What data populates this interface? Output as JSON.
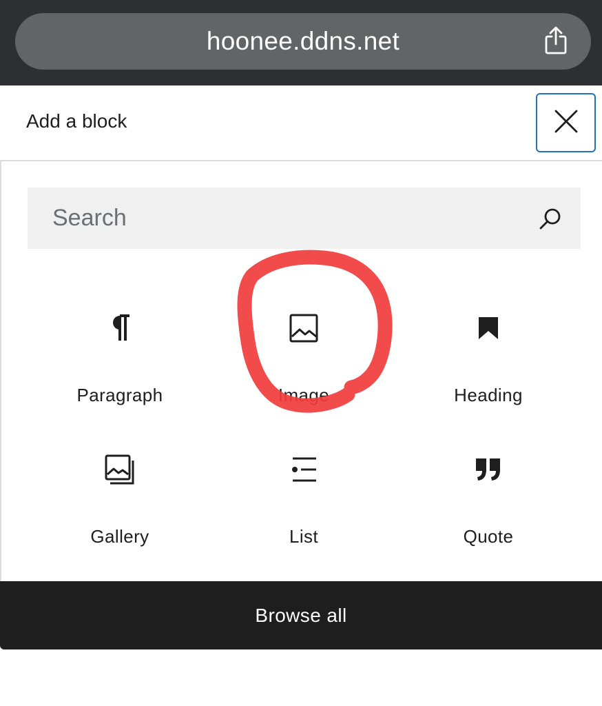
{
  "browser": {
    "url": "hoonee.ddns.net",
    "share_icon": "share-icon"
  },
  "header": {
    "title": "Add a block",
    "close_icon": "close-icon"
  },
  "search": {
    "placeholder": "Search",
    "value": "",
    "icon": "search-icon"
  },
  "blocks": [
    {
      "label": "Paragraph",
      "icon": "paragraph-icon"
    },
    {
      "label": "Image",
      "icon": "image-icon"
    },
    {
      "label": "Heading",
      "icon": "bookmark-icon"
    },
    {
      "label": "Gallery",
      "icon": "gallery-icon"
    },
    {
      "label": "List",
      "icon": "list-icon"
    },
    {
      "label": "Quote",
      "icon": "quote-icon"
    }
  ],
  "footer": {
    "browse_label": "Browse all"
  },
  "colors": {
    "accent": "#2271b1",
    "annotation": "#f03c3c",
    "footer_bg": "#1e1e1e",
    "browser_bg": "#2d3033"
  }
}
